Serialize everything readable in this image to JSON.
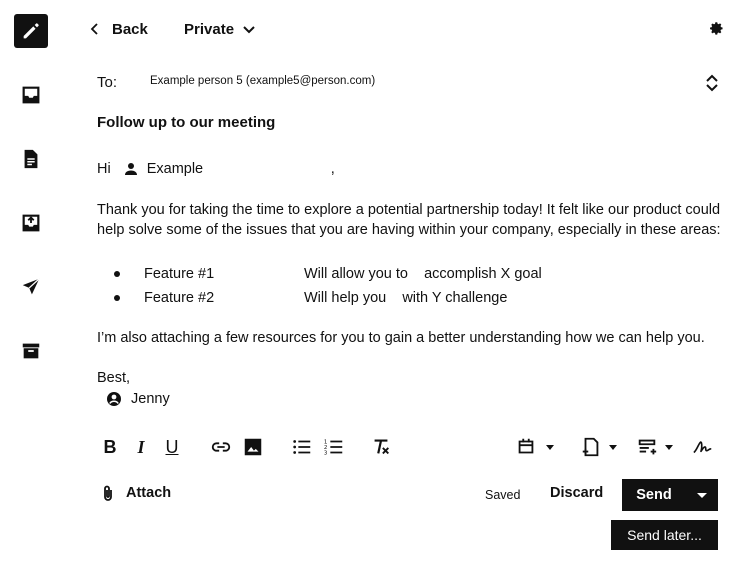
{
  "rail": {
    "items": [
      {
        "icon": "compose-icon",
        "active": true
      },
      {
        "icon": "inbox-icon"
      },
      {
        "icon": "drafts-icon"
      },
      {
        "icon": "outbox-icon"
      },
      {
        "icon": "sent-icon"
      },
      {
        "icon": "archive-icon"
      }
    ]
  },
  "header": {
    "back_label": "Back",
    "privacy_label": "Private"
  },
  "to": {
    "label": "To:",
    "value": "Example person 5 (example5@person.com)"
  },
  "subject": "Follow up to our meeting",
  "body": {
    "greeting": "Hi",
    "recipient_name": "Example",
    "comma": ",",
    "paragraph1_line1": "Thank you for taking the time to explore a potential partnership today! It felt like our product could",
    "paragraph1_line2": "help solve some of the issues that you are having within your company, especially in these areas:",
    "bullets": [
      {
        "feature": "Feature #1",
        "text": "Will allow you to    accomplish X goal"
      },
      {
        "feature": "Feature #2",
        "text": "Will help you    with Y challenge"
      }
    ],
    "paragraph2": "I’m also attaching a few resources for you to gain a better understanding how we can help you.",
    "closing": "Best,",
    "signature_name": "Jenny"
  },
  "toolbar": {
    "bold": "B",
    "italic": "I",
    "underline": "U"
  },
  "footer": {
    "attach_label": "Attach",
    "status": "Saved",
    "discard_label": "Discard",
    "send_label": "Send",
    "send_later_label": "Send later..."
  }
}
